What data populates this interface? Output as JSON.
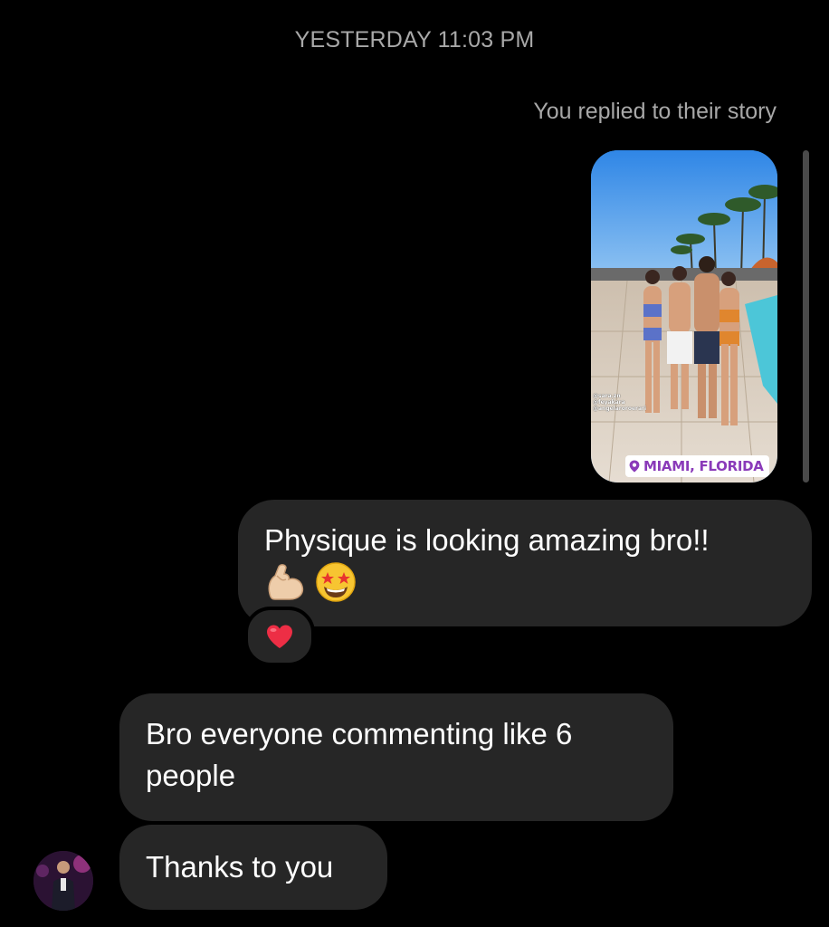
{
  "thread": {
    "timestamp": "YESTERDAY 11:03 PM",
    "reply_note": "You replied to their story"
  },
  "story": {
    "location": "MIAMI, FLORIDA",
    "mentions": [
      "@sara.zn",
      "@feyakara",
      "@angelaroroerari"
    ],
    "location_icon": "location-pin-icon"
  },
  "messages": {
    "sent": {
      "text": "Physique is looking amazing bro!!",
      "emojis": [
        "flexed-biceps-emoji",
        "star-struck-emoji"
      ],
      "reaction": "heart-emoji"
    },
    "received": [
      {
        "text": "Bro everyone commenting like 6 people"
      },
      {
        "text": "Thanks to you"
      }
    ]
  },
  "colors": {
    "background": "#000000",
    "bubble": "#262626",
    "meta_text": "#a8a8a8",
    "location_text": "#8a3ab9"
  }
}
